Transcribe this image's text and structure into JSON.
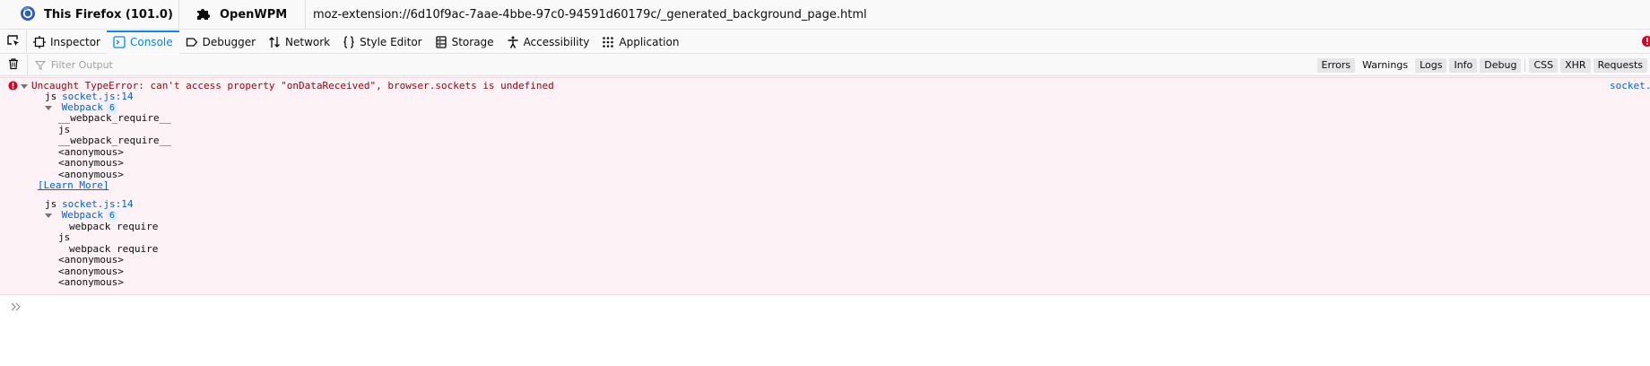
{
  "target_bar": {
    "firefox_label": "This Firefox (101.0)",
    "openwpm_label": "OpenWPM",
    "url": "moz-extension://6d10f9ac-7aae-4bbe-97c0-94591d60179c/_generated_background_page.html"
  },
  "toolbar": {
    "tabs": [
      {
        "label": "Inspector",
        "icon": "inspector-icon"
      },
      {
        "label": "Console",
        "icon": "console-icon",
        "selected": true
      },
      {
        "label": "Debugger",
        "icon": "debugger-icon"
      },
      {
        "label": "Network",
        "icon": "network-icon"
      },
      {
        "label": "Style Editor",
        "icon": "style-editor-icon"
      },
      {
        "label": "Storage",
        "icon": "storage-icon"
      },
      {
        "label": "Accessibility",
        "icon": "accessibility-icon"
      },
      {
        "label": "Application",
        "icon": "application-icon"
      }
    ]
  },
  "filter": {
    "placeholder": "Filter Output",
    "buttons": {
      "errors": "Errors",
      "warnings": "Warnings",
      "logs": "Logs",
      "info": "Info",
      "debug": "Debug",
      "css": "CSS",
      "xhr": "XHR",
      "requests": "Requests"
    }
  },
  "console": {
    "error_message": "Uncaught TypeError: can't access property \"onDataReceived\", browser.sockets is undefined",
    "source_link": "socket.js",
    "stack1": {
      "frame_name": "js",
      "frame_src": "socket.js:14",
      "group_label": "Webpack",
      "group_count": "6",
      "frames": [
        "__webpack_require__",
        "js",
        "__webpack_require__",
        "<anonymous>",
        "<anonymous>",
        "<anonymous>"
      ]
    },
    "learn_more": "[Learn More]",
    "stack2": {
      "frame_name": "js",
      "frame_src": "socket.js:14",
      "group_label": "Webpack",
      "group_count": "6",
      "frames": [
        "webpack require",
        "js",
        "webpack require",
        "<anonymous>",
        "<anonymous>",
        "<anonymous>"
      ]
    }
  },
  "colors": {
    "accent": "#0a84ff",
    "error_text": "#a4000f",
    "error_bg": "#fdf2f5",
    "link": "#0060df"
  }
}
